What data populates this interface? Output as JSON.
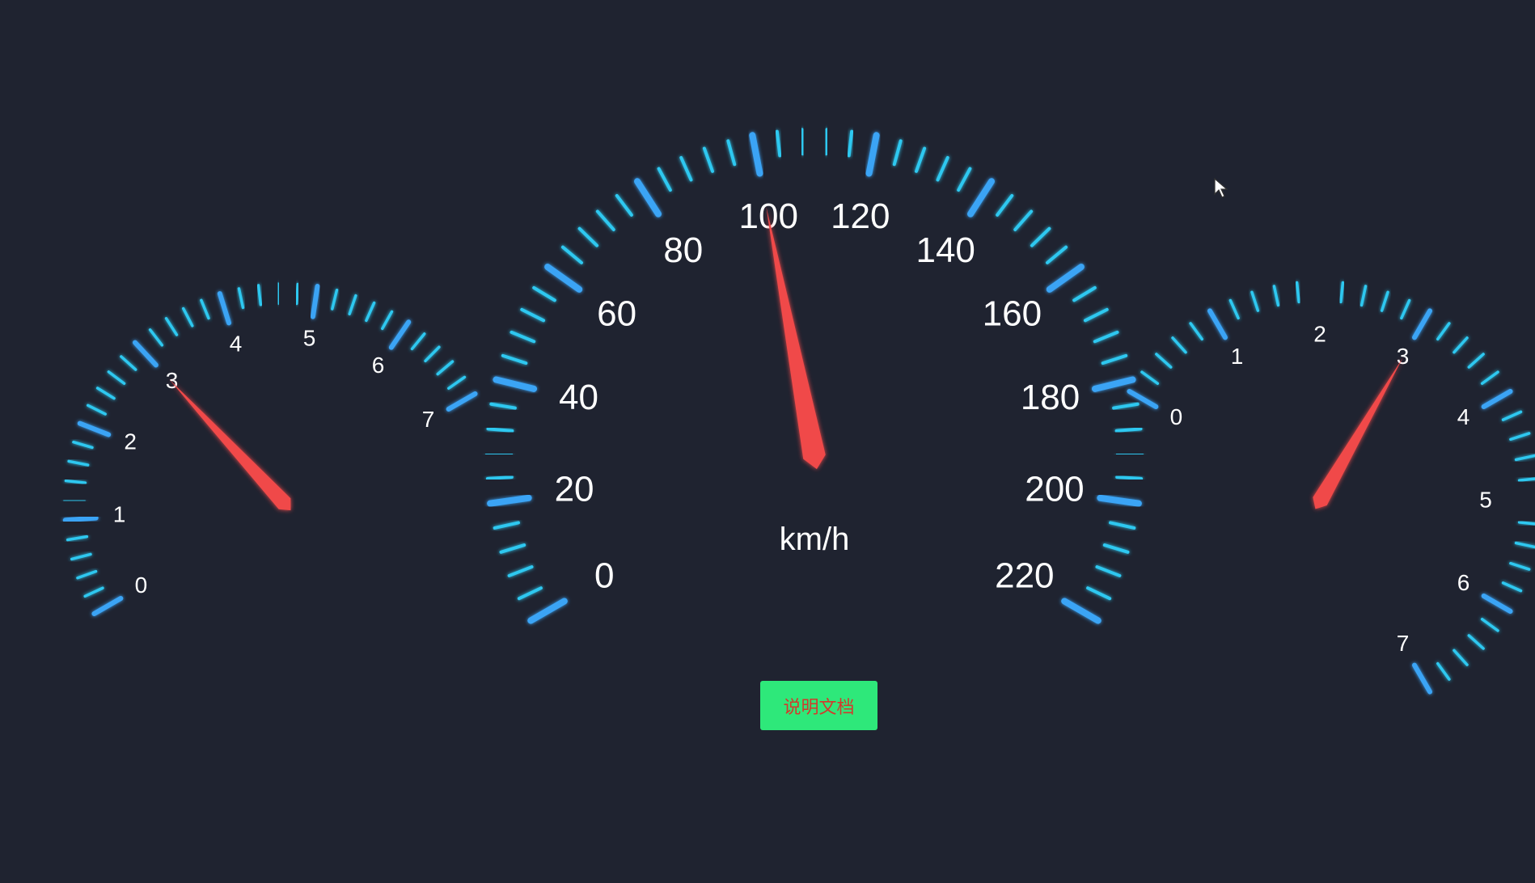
{
  "colors": {
    "background": "#1f2330",
    "tick": "#2ec8f0",
    "tick_major": "#3aa4f5",
    "needle": "#f04a4a",
    "label": "#ffffff",
    "button_bg": "#2ee87a",
    "button_text": "#d23a2c"
  },
  "speedometer": {
    "unit": "km/h",
    "value": 100,
    "labels": [
      "0",
      "20",
      "40",
      "60",
      "80",
      "100",
      "120",
      "140",
      "160",
      "180",
      "200",
      "220"
    ]
  },
  "left_gauge": {
    "value": 3,
    "labels": [
      "0",
      "1",
      "2",
      "3",
      "4",
      "5",
      "6",
      "7"
    ]
  },
  "right_gauge": {
    "value": 3,
    "labels": [
      "0",
      "1",
      "2",
      "3",
      "4",
      "5",
      "6",
      "7"
    ]
  },
  "doc_button": {
    "label": "说明文档"
  },
  "icons": {
    "cursor": "mouse-pointer-icon"
  }
}
